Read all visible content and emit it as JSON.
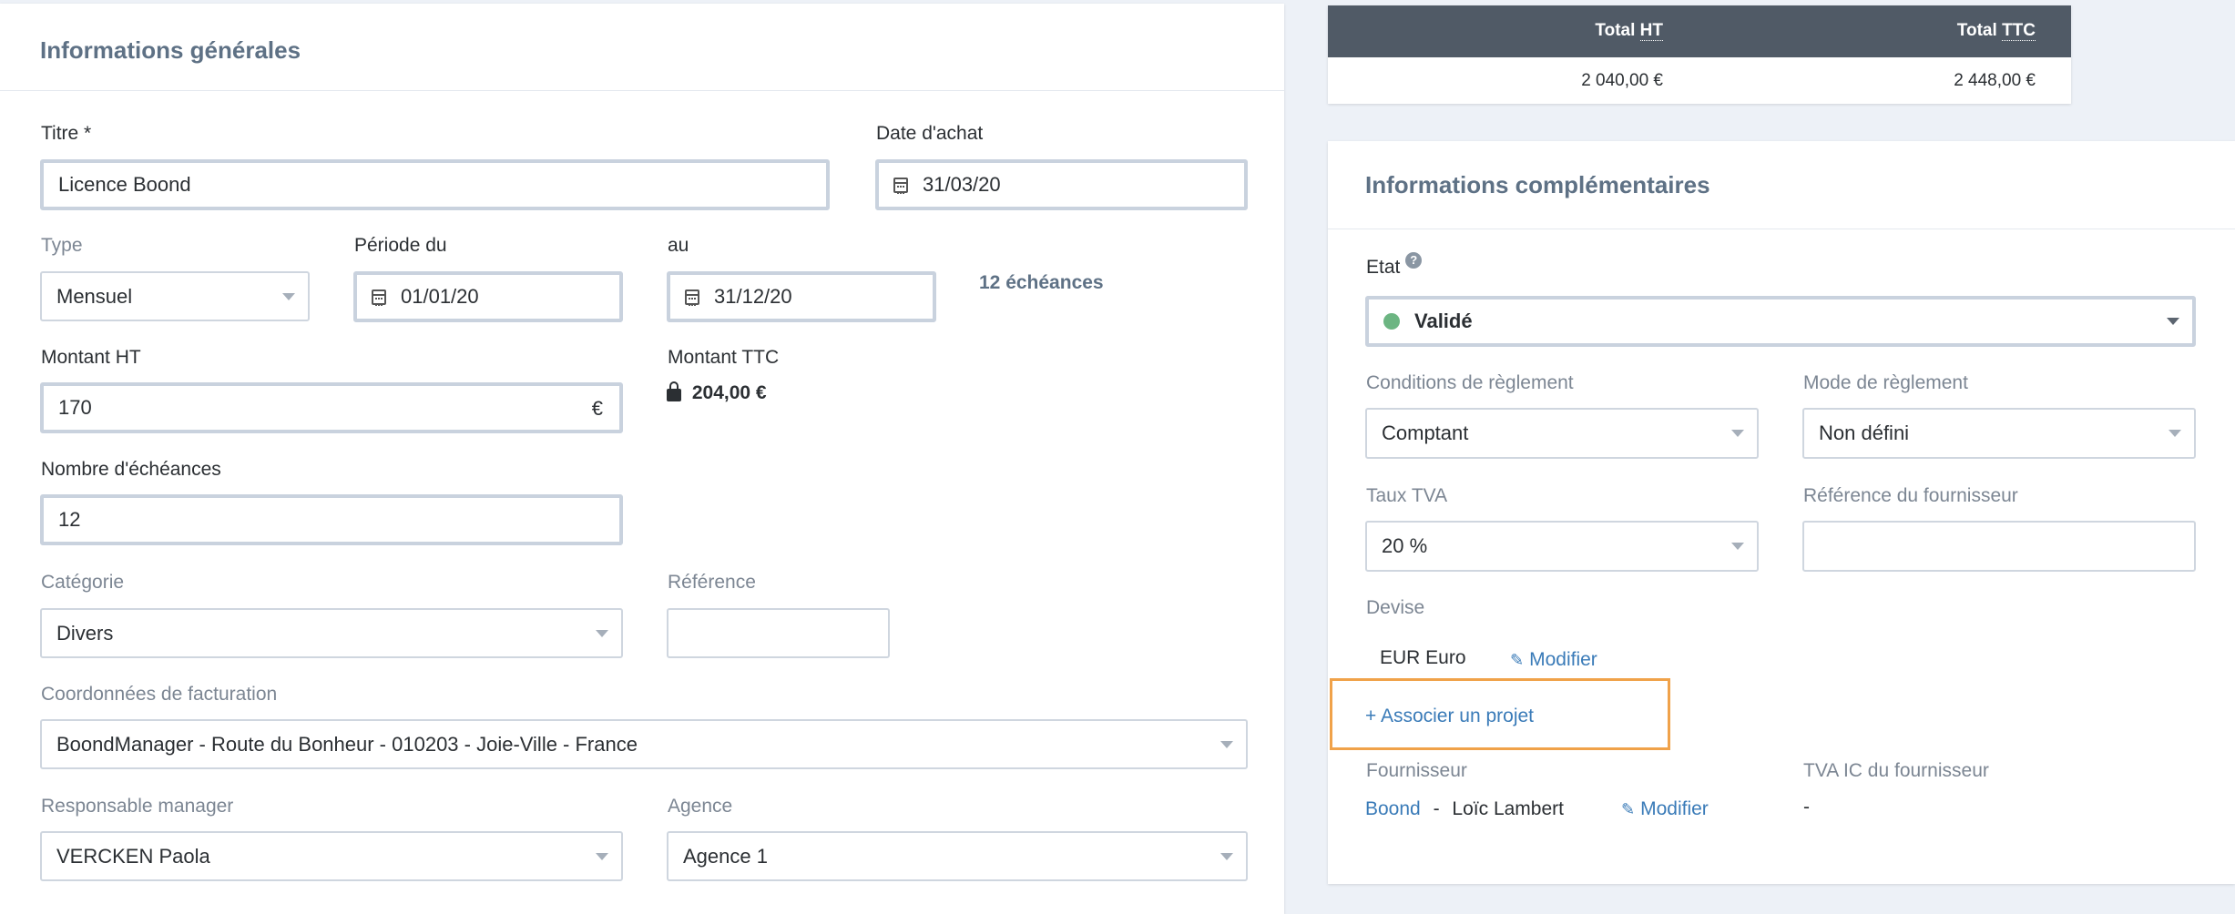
{
  "general": {
    "title": "Informations générales",
    "titre_label": "Titre *",
    "titre_value": "Licence Boond",
    "date_achat_label": "Date d'achat",
    "date_achat_value": "31/03/20",
    "type_label": "Type",
    "type_value": "Mensuel",
    "periode_du_label": "Période du",
    "periode_du_value": "01/01/20",
    "au_label": "au",
    "au_value": "31/12/20",
    "echeances_summary": "12 échéances",
    "montant_ht_label": "Montant HT",
    "montant_ht_value": "170",
    "currency_symbol": "€",
    "montant_ttc_label": "Montant TTC",
    "montant_ttc_value": "204,00 €",
    "nombre_echeances_label": "Nombre d'échéances",
    "nombre_echeances_value": "12",
    "categorie_label": "Catégorie",
    "categorie_value": "Divers",
    "reference_label": "Référence",
    "reference_value": "",
    "coordonnees_label": "Coordonnées de facturation",
    "coordonnees_value": "BoondManager - Route du Bonheur - 010203 - Joie-Ville - France",
    "responsable_label": "Responsable manager",
    "responsable_value": "VERCKEN Paola",
    "agence_label": "Agence",
    "agence_value": "Agence 1"
  },
  "totals": {
    "col_ht_prefix": "Total ",
    "col_ht_abbr": "HT",
    "col_ttc_prefix": "Total ",
    "col_ttc_abbr": "TTC",
    "ht_value": "2 040,00 €",
    "ttc_value": "2 448,00 €"
  },
  "complementary": {
    "title": "Informations complémentaires",
    "etat_label": "Etat",
    "help_icon": "?",
    "etat_value": "Validé",
    "etat_color": "#6cb582",
    "conditions_label": "Conditions de règlement",
    "conditions_value": "Comptant",
    "mode_label": "Mode de règlement",
    "mode_value": "Non défini",
    "taux_label": "Taux TVA",
    "taux_value": "20 %",
    "ref_fournisseur_label": "Référence du fournisseur",
    "ref_fournisseur_value": "",
    "devise_label": "Devise",
    "devise_value": "EUR Euro",
    "modifier_label": "Modifier",
    "associer_label": "+ Associer un projet",
    "highlight_color": "#f0a24a",
    "fournisseur_label": "Fournisseur",
    "fournisseur_company": "Boond",
    "fournisseur_separator": "-",
    "fournisseur_contact": "Loïc Lambert",
    "tva_ic_label": "TVA IC du fournisseur",
    "tva_ic_value": "-"
  },
  "icons": {
    "calendar": "calendar-icon",
    "lock": "lock-icon",
    "pencil": "pencil-icon",
    "caret": "chevron-down-icon",
    "help": "help-icon"
  }
}
